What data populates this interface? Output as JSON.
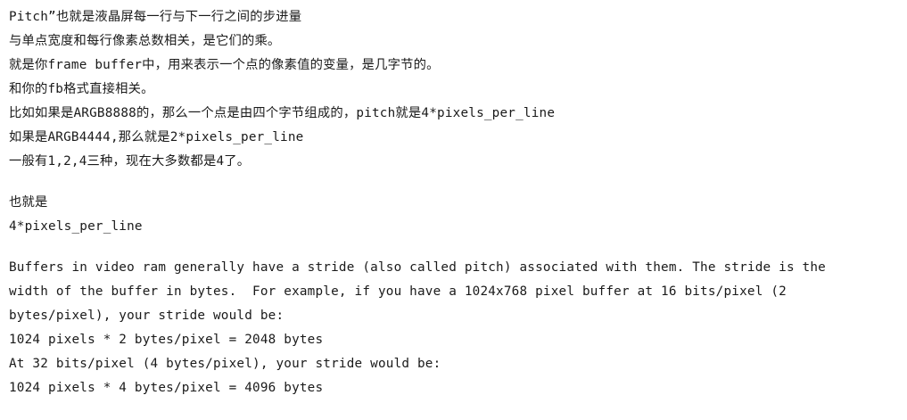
{
  "notes_cn": [
    "Pitch”也就是液晶屏每一行与下一行之间的步进量",
    "与单点宽度和每行像素总数相关，是它们的乘。",
    "就是你frame buffer中，用来表示一个点的像素值的变量，是几字节的。",
    "和你的fb格式直接相关。",
    "比如如果是ARGB8888的，那么一个点是由四个字节组成的，pitch就是4*pixels_per_line",
    "如果是ARGB4444,那么就是2*pixels_per_line",
    "一般有1,2,4三种，现在大多数都是4了。"
  ],
  "summary": {
    "label": "也就是",
    "formula": "4*pixels_per_line"
  },
  "english": {
    "para_line1": "Buffers in video ram generally have a stride (also called pitch) associated with them. The stride is the",
    "para_line2": "width of the buffer in bytes.  For example, if you have a 1024x768 pixel buffer at 16 bits/pixel (2",
    "para_line3": "bytes/pixel), your stride would be:",
    "calc_16bpp": "1024 pixels * 2 bytes/pixel = 2048 bytes",
    "intro_32bpp": "At 32 bits/pixel (4 bytes/pixel), your stride would be:",
    "calc_32bpp": "1024 pixels * 4 bytes/pixel = 4096 bytes"
  }
}
